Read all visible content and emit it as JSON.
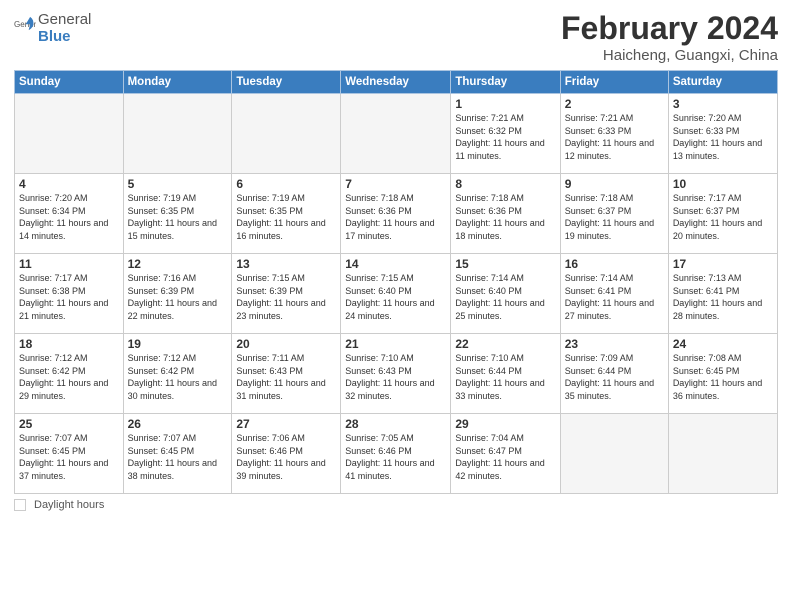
{
  "header": {
    "logo_general": "General",
    "logo_blue": "Blue",
    "main_title": "February 2024",
    "subtitle": "Haicheng, Guangxi, China"
  },
  "weekdays": [
    "Sunday",
    "Monday",
    "Tuesday",
    "Wednesday",
    "Thursday",
    "Friday",
    "Saturday"
  ],
  "footer": {
    "legend_label": "Daylight hours"
  },
  "weeks": [
    [
      {
        "day": "",
        "empty": true
      },
      {
        "day": "",
        "empty": true
      },
      {
        "day": "",
        "empty": true
      },
      {
        "day": "",
        "empty": true
      },
      {
        "day": "1",
        "sunrise": "7:21 AM",
        "sunset": "6:32 PM",
        "daylight": "11 hours and 11 minutes."
      },
      {
        "day": "2",
        "sunrise": "7:21 AM",
        "sunset": "6:33 PM",
        "daylight": "11 hours and 12 minutes."
      },
      {
        "day": "3",
        "sunrise": "7:20 AM",
        "sunset": "6:33 PM",
        "daylight": "11 hours and 13 minutes."
      }
    ],
    [
      {
        "day": "4",
        "sunrise": "7:20 AM",
        "sunset": "6:34 PM",
        "daylight": "11 hours and 14 minutes."
      },
      {
        "day": "5",
        "sunrise": "7:19 AM",
        "sunset": "6:35 PM",
        "daylight": "11 hours and 15 minutes."
      },
      {
        "day": "6",
        "sunrise": "7:19 AM",
        "sunset": "6:35 PM",
        "daylight": "11 hours and 16 minutes."
      },
      {
        "day": "7",
        "sunrise": "7:18 AM",
        "sunset": "6:36 PM",
        "daylight": "11 hours and 17 minutes."
      },
      {
        "day": "8",
        "sunrise": "7:18 AM",
        "sunset": "6:36 PM",
        "daylight": "11 hours and 18 minutes."
      },
      {
        "day": "9",
        "sunrise": "7:18 AM",
        "sunset": "6:37 PM",
        "daylight": "11 hours and 19 minutes."
      },
      {
        "day": "10",
        "sunrise": "7:17 AM",
        "sunset": "6:37 PM",
        "daylight": "11 hours and 20 minutes."
      }
    ],
    [
      {
        "day": "11",
        "sunrise": "7:17 AM",
        "sunset": "6:38 PM",
        "daylight": "11 hours and 21 minutes."
      },
      {
        "day": "12",
        "sunrise": "7:16 AM",
        "sunset": "6:39 PM",
        "daylight": "11 hours and 22 minutes."
      },
      {
        "day": "13",
        "sunrise": "7:15 AM",
        "sunset": "6:39 PM",
        "daylight": "11 hours and 23 minutes."
      },
      {
        "day": "14",
        "sunrise": "7:15 AM",
        "sunset": "6:40 PM",
        "daylight": "11 hours and 24 minutes."
      },
      {
        "day": "15",
        "sunrise": "7:14 AM",
        "sunset": "6:40 PM",
        "daylight": "11 hours and 25 minutes."
      },
      {
        "day": "16",
        "sunrise": "7:14 AM",
        "sunset": "6:41 PM",
        "daylight": "11 hours and 27 minutes."
      },
      {
        "day": "17",
        "sunrise": "7:13 AM",
        "sunset": "6:41 PM",
        "daylight": "11 hours and 28 minutes."
      }
    ],
    [
      {
        "day": "18",
        "sunrise": "7:12 AM",
        "sunset": "6:42 PM",
        "daylight": "11 hours and 29 minutes."
      },
      {
        "day": "19",
        "sunrise": "7:12 AM",
        "sunset": "6:42 PM",
        "daylight": "11 hours and 30 minutes."
      },
      {
        "day": "20",
        "sunrise": "7:11 AM",
        "sunset": "6:43 PM",
        "daylight": "11 hours and 31 minutes."
      },
      {
        "day": "21",
        "sunrise": "7:10 AM",
        "sunset": "6:43 PM",
        "daylight": "11 hours and 32 minutes."
      },
      {
        "day": "22",
        "sunrise": "7:10 AM",
        "sunset": "6:44 PM",
        "daylight": "11 hours and 33 minutes."
      },
      {
        "day": "23",
        "sunrise": "7:09 AM",
        "sunset": "6:44 PM",
        "daylight": "11 hours and 35 minutes."
      },
      {
        "day": "24",
        "sunrise": "7:08 AM",
        "sunset": "6:45 PM",
        "daylight": "11 hours and 36 minutes."
      }
    ],
    [
      {
        "day": "25",
        "sunrise": "7:07 AM",
        "sunset": "6:45 PM",
        "daylight": "11 hours and 37 minutes."
      },
      {
        "day": "26",
        "sunrise": "7:07 AM",
        "sunset": "6:45 PM",
        "daylight": "11 hours and 38 minutes."
      },
      {
        "day": "27",
        "sunrise": "7:06 AM",
        "sunset": "6:46 PM",
        "daylight": "11 hours and 39 minutes."
      },
      {
        "day": "28",
        "sunrise": "7:05 AM",
        "sunset": "6:46 PM",
        "daylight": "11 hours and 41 minutes."
      },
      {
        "day": "29",
        "sunrise": "7:04 AM",
        "sunset": "6:47 PM",
        "daylight": "11 hours and 42 minutes."
      },
      {
        "day": "",
        "empty": true
      },
      {
        "day": "",
        "empty": true
      }
    ]
  ]
}
